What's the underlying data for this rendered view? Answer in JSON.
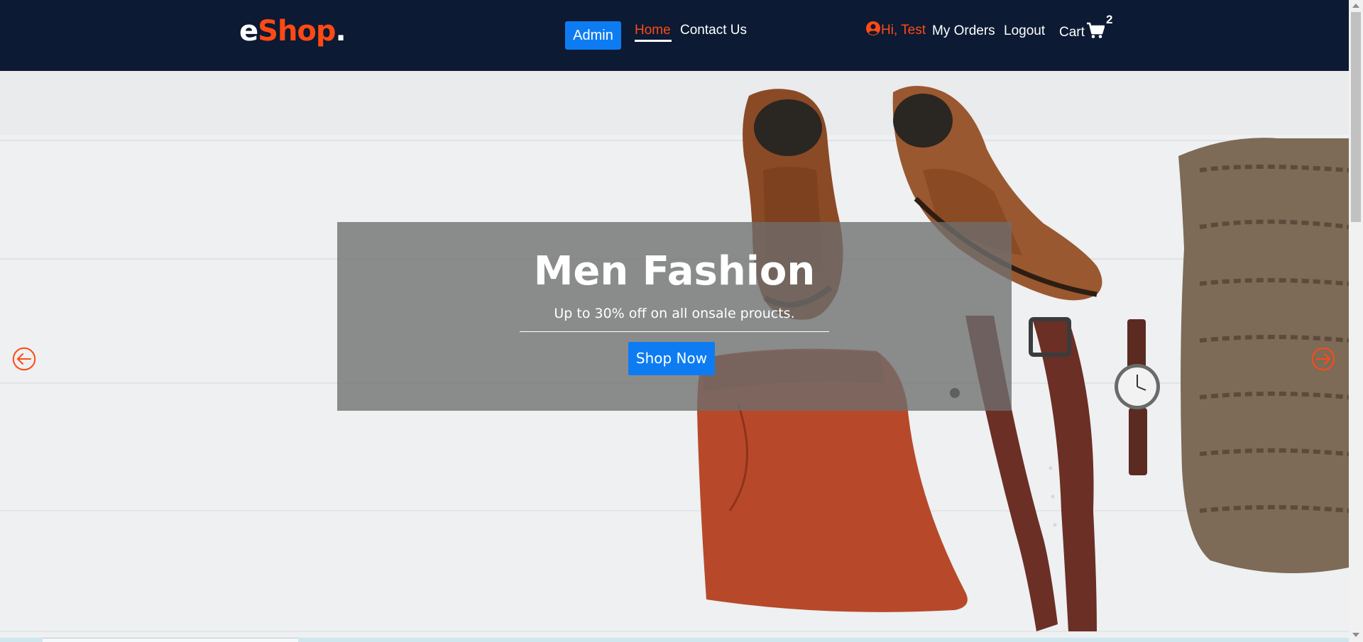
{
  "brand": {
    "logo_e": "e",
    "logo_shop": "Shop",
    "logo_dot": "."
  },
  "nav": {
    "admin_label": "Admin",
    "home_label": "Home",
    "contact_label": "Contact Us",
    "greeting": "Hi, Test",
    "orders_label": "My Orders",
    "logout_label": "Logout",
    "cart_label": "Cart",
    "cart_count": "2"
  },
  "hero": {
    "title": "Men Fashion",
    "subtitle": "Up to 30% off on all onsale proucts.",
    "cta_label": "Shop Now"
  },
  "icons": {
    "user": "user-circle-icon",
    "cart": "shopping-cart-icon",
    "prev": "arrow-circle-left-icon",
    "next": "arrow-circle-right-icon"
  },
  "colors": {
    "navbar_bg": "#0c1a33",
    "accent": "#ff4a14",
    "button_blue": "#0d7cf2"
  }
}
